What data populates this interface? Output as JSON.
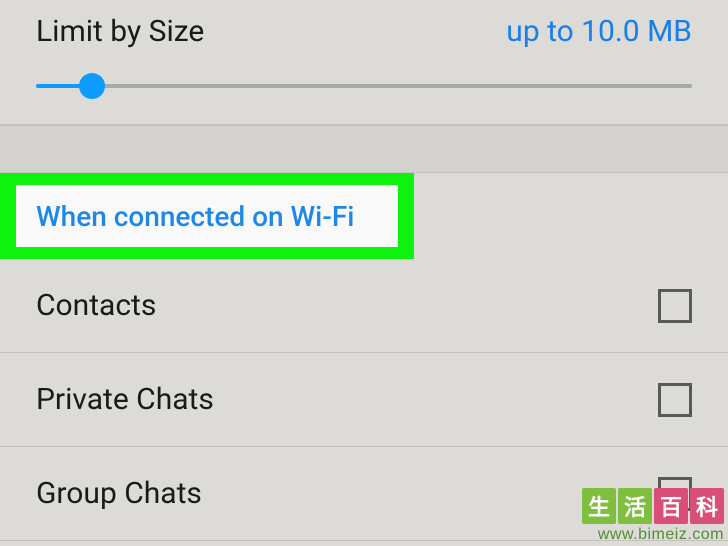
{
  "limit": {
    "label": "Limit by Size",
    "value": "up to 10.0 MB",
    "slider_percent": 8.5
  },
  "section_header": "When connected on Wi-Fi",
  "items": [
    {
      "label": "Contacts",
      "checked": false
    },
    {
      "label": "Private Chats",
      "checked": false
    },
    {
      "label": "Group Chats",
      "checked": false
    }
  ],
  "watermark": {
    "chars": [
      "生",
      "活",
      "百",
      "科"
    ],
    "url": "www.bimeiz.com"
  }
}
